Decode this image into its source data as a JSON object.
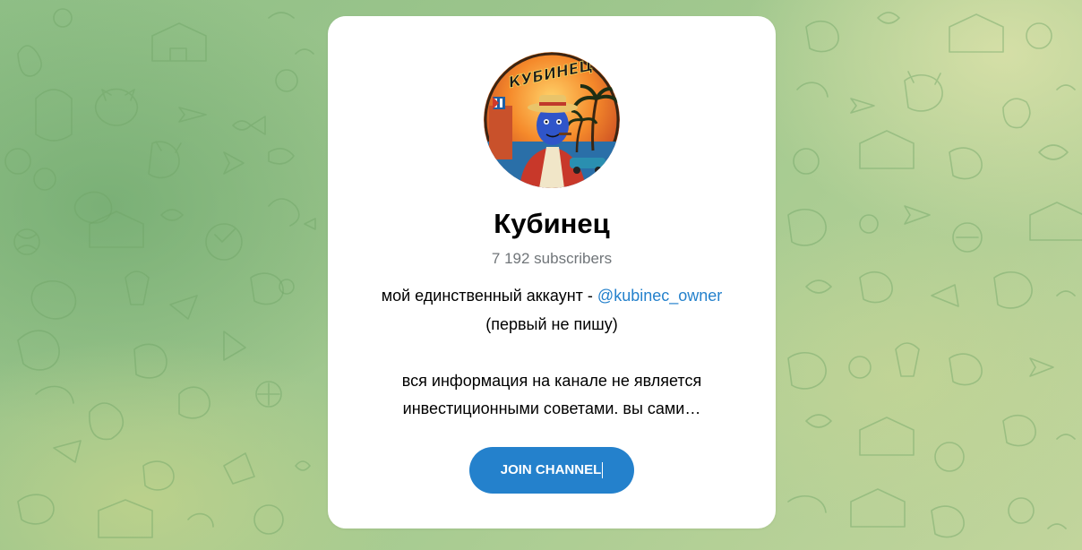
{
  "channel": {
    "name": "Кубинец",
    "subscribers": "7 192 subscribers",
    "avatar_text": "КУБИНЕЦ",
    "description": {
      "line1_text": "мой единственный аккаунт - ",
      "line1_link": "@kubinec_owner",
      "line2": "(первый не пишу)",
      "line3": "вся информация на канале не является",
      "line4": "инвестиционными советами. вы сами…"
    }
  },
  "actions": {
    "join_label": "JOIN CHANNEL"
  },
  "colors": {
    "accent": "#2481cc",
    "title": "#000000",
    "muted": "#707579",
    "card": "#ffffff",
    "background_green": "#9cc58c"
  },
  "icons": {
    "background_pattern": "telegram-doodle-pattern",
    "avatar": "channel-avatar-image"
  }
}
